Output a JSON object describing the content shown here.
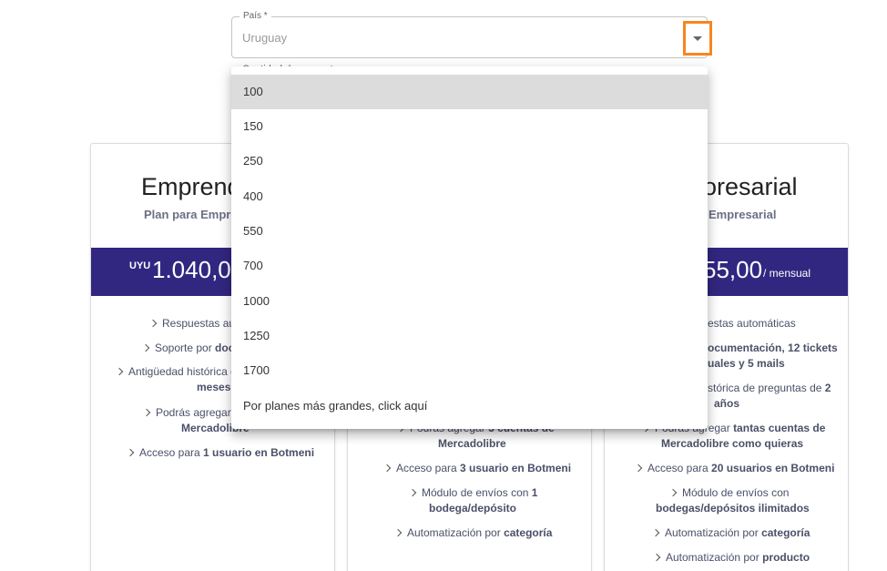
{
  "country_field": {
    "label": "País *",
    "value": "Uruguay"
  },
  "hidden_label": "Cantidad de preguntas",
  "dropdown": {
    "options": [
      "100",
      "150",
      "250",
      "400",
      "550",
      "700",
      "1000",
      "1250",
      "1700",
      "Por planes más grandes, click aquí"
    ],
    "selected": "100"
  },
  "plans": {
    "left": {
      "title": "Emprend",
      "subtitle": "Plan para Empre",
      "currency": "UYU",
      "amount": "1.040,0",
      "features": [
        {
          "pre": "Respuestas au",
          "bold": "",
          "post": ""
        },
        {
          "pre": "Soporte por ",
          "bold": "doc",
          "post": ""
        },
        {
          "pre": "Antigüedad histórica d",
          "bold": "",
          "post": ""
        },
        {
          "pre": "",
          "bold": "meses",
          "post": ""
        },
        {
          "pre": "Podrás agregar",
          "bold": "",
          "post": ""
        },
        {
          "pre": "",
          "bold": "Mercadolibre",
          "post": ""
        },
        {
          "pre": "Acceso para ",
          "bold": "1 usuario en Botmeni",
          "post": ""
        }
      ]
    },
    "middle": {
      "features": [
        {
          "pre": "Podrás agregar ",
          "bold": "3 cuentas de",
          "post": ""
        },
        {
          "pre": "",
          "bold": "Mercadolibre",
          "post": ""
        },
        {
          "pre": "Acceso para ",
          "bold": "3 usuario en Botmeni",
          "post": ""
        },
        {
          "pre": "Módulo de envíos con ",
          "bold": "1",
          "post": ""
        },
        {
          "pre": "",
          "bold": "bodega/depósito",
          "post": ""
        },
        {
          "pre": "Automatización por ",
          "bold": "categoría",
          "post": ""
        }
      ]
    },
    "right": {
      "title": "oresarial",
      "subtitle": "Empresarial",
      "amount": "55,00",
      "period": "/ mensual",
      "features": [
        {
          "pre": "estas automáticas",
          "bold": "",
          "post": ""
        },
        {
          "pre": "",
          "bold": "ocumentación, 12 tickets",
          "post": ""
        },
        {
          "pre": "",
          "bold": "uales y 5 mails",
          "post": ""
        },
        {
          "pre": "stórica de preguntas de ",
          "bold": "2",
          "post": ""
        },
        {
          "pre": "",
          "bold": "años",
          "post": ""
        },
        {
          "pre": "Podrás agregar ",
          "bold": "tantas cuentas de",
          "post": ""
        },
        {
          "pre": "",
          "bold": "Mercadolibre como quieras",
          "post": ""
        },
        {
          "pre": "Acceso para ",
          "bold": "20 usuarios en Botmeni",
          "post": ""
        },
        {
          "pre": "Módulo de envíos con",
          "bold": "",
          "post": ""
        },
        {
          "pre": "",
          "bold": "bodegas/depósitos ilimitados",
          "post": ""
        },
        {
          "pre": "Automatización por ",
          "bold": "categoría",
          "post": ""
        },
        {
          "pre": "Automatización por ",
          "bold": "producto",
          "post": ""
        }
      ]
    }
  }
}
